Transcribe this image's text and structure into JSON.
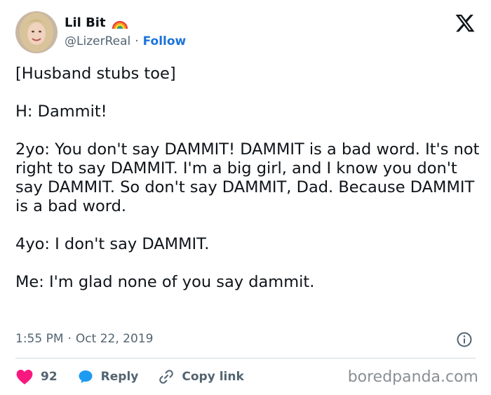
{
  "user": {
    "display_name": "Lil Bit",
    "badge_emoji": "rainbow-icon",
    "handle": "@LizerReal",
    "separator": "·",
    "follow_label": "Follow"
  },
  "tweet": {
    "lines": [
      "[Husband stubs toe]",
      "H: Dammit!",
      "2yo: You don't say DAMMIT! DAMMIT is a bad word. It's not right to say DAMMIT. I'm a big girl, and I know you don't say DAMMIT. So don't say DAMMIT, Dad. Because DAMMIT is a bad word.",
      "4yo: I don't say DAMMIT.",
      "Me: I'm glad none of you say dammit."
    ],
    "time": "1:55 PM",
    "separator": "·",
    "date": "Oct 22, 2019"
  },
  "actions": {
    "like_count": "92",
    "reply_label": "Reply",
    "copy_label": "Copy link"
  },
  "watermark": "boredpanda.com",
  "colors": {
    "follow": "#1d74d9",
    "like": "#f91880",
    "reply": "#1d9bf0",
    "muted": "#536471"
  }
}
